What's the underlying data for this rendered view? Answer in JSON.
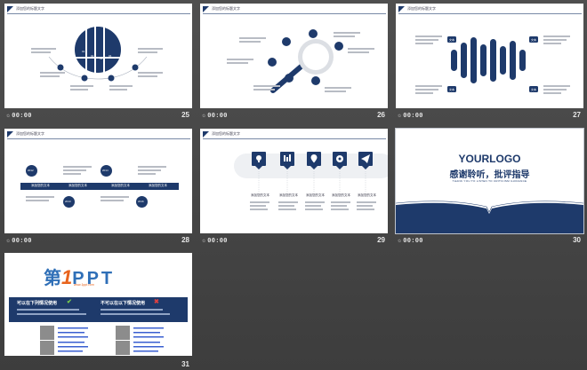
{
  "slides": [
    {
      "number": "25",
      "timing": "00:00",
      "header": "添加您的标题文字",
      "labels": [
        "01",
        "02",
        "03",
        "04"
      ]
    },
    {
      "number": "26",
      "timing": "00:00",
      "header": "添加您的标题文字"
    },
    {
      "number": "27",
      "timing": "00:00",
      "header": "添加您的标题文字",
      "labels": [
        "文本",
        "文本",
        "文本",
        "文本"
      ]
    },
    {
      "number": "28",
      "timing": "00:00",
      "header": "添加您的标题文字",
      "years": [
        "2012",
        "2014",
        "2013",
        "2016"
      ],
      "boxes": [
        "添加您的文本",
        "添加您的文本",
        "添加您的文本",
        "添加您的文本"
      ]
    },
    {
      "number": "29",
      "timing": "00:00",
      "header": "添加您的标题文字",
      "captions": [
        "添加您的文本",
        "添加您的文本",
        "添加您的文本",
        "添加您的文本",
        "添加您的文本"
      ]
    },
    {
      "number": "30",
      "timing": "00:00",
      "logo": "YOURLOGO",
      "thanks": "感谢聆听，批评指导",
      "sub": "THANK YOU TO LISTEN TO CRITICISM GUIDANCE"
    },
    {
      "number": "31",
      "timing": "",
      "brand_a": "第",
      "brand_1": "1",
      "brand_b": "PPT",
      "brand_url": "www.1ppt.com",
      "left_head": "可以在下列情况使用",
      "right_head": "不可以在以下情况使用"
    }
  ],
  "colors": {
    "navy": "#1e3a6b",
    "bg": "#474747"
  }
}
